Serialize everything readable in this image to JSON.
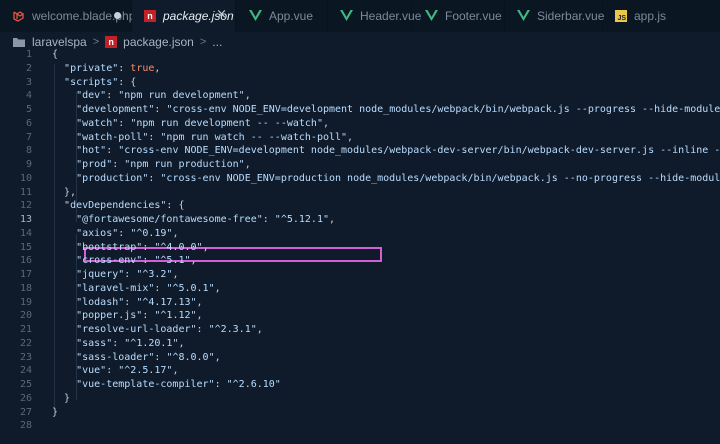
{
  "tabs": [
    {
      "label": "welcome.blade.php",
      "icon": "laravel-icon",
      "state": "modified"
    },
    {
      "label": "package.json",
      "icon": "npm-icon",
      "state": "active"
    },
    {
      "label": "App.vue",
      "icon": "vue-icon"
    },
    {
      "label": "Header.vue",
      "icon": "vue-icon"
    },
    {
      "label": "Footer.vue",
      "icon": "vue-icon"
    },
    {
      "label": "Siderbar.vue",
      "icon": "vue-icon"
    },
    {
      "label": "app.js",
      "icon": "js-icon"
    }
  ],
  "icon_text": {
    "npm": "n",
    "js": "JS"
  },
  "tab_close_glyph": "×",
  "breadcrumb": {
    "folder": "laravelspa",
    "file": "package.json",
    "sep": ">",
    "more": "..."
  },
  "colors": {
    "key": "#b9dcff",
    "string": "#b9dcff",
    "boolean": "#f78c6c",
    "punct": "#c9d1d9",
    "highlight": "#d35fd7",
    "vue": "#41b883"
  },
  "lines": [
    {
      "n": "1",
      "t": "{"
    },
    {
      "n": "2",
      "t": "  \"private\": true,"
    },
    {
      "n": "3",
      "t": "  \"scripts\": {"
    },
    {
      "n": "4",
      "t": "    \"dev\": \"npm run development\","
    },
    {
      "n": "5",
      "t": "    \"development\": \"cross-env NODE_ENV=development node_modules/webpack/bin/webpack.js --progress --hide-modules --config=node_modules/laravel-mix/setup/webpack.config.js\","
    },
    {
      "n": "6",
      "t": "    \"watch\": \"npm run development -- --watch\","
    },
    {
      "n": "7",
      "t": "    \"watch-poll\": \"npm run watch -- --watch-poll\","
    },
    {
      "n": "8",
      "t": "    \"hot\": \"cross-env NODE_ENV=development node_modules/webpack-dev-server/bin/webpack-dev-server.js --inline --hot --config=node_modules/laravel-mix/setup/webpack.config.js\","
    },
    {
      "n": "9",
      "t": "    \"prod\": \"npm run production\","
    },
    {
      "n": "10",
      "t": "    \"production\": \"cross-env NODE_ENV=production node_modules/webpack/bin/webpack.js --no-progress --hide-modules --config=node_modules/laravel-mix/setup/webpack.config.js\""
    },
    {
      "n": "11",
      "t": "  },"
    },
    {
      "n": "12",
      "t": "  \"devDependencies\": {"
    },
    {
      "n": "13",
      "t": "    \"@fortawesome/fontawesome-free\": \"^5.12.1\","
    },
    {
      "n": "14",
      "t": "    \"axios\": \"^0.19\","
    },
    {
      "n": "15",
      "t": "    \"bootstrap\": \"^4.0.0\","
    },
    {
      "n": "16",
      "t": "    \"cross-env\": \"^5.1\","
    },
    {
      "n": "17",
      "t": "    \"jquery\": \"^3.2\","
    },
    {
      "n": "18",
      "t": "    \"laravel-mix\": \"^5.0.1\","
    },
    {
      "n": "19",
      "t": "    \"lodash\": \"^4.17.13\","
    },
    {
      "n": "20",
      "t": "    \"popper.js\": \"^1.12\","
    },
    {
      "n": "21",
      "t": "    \"resolve-url-loader\": \"^2.3.1\","
    },
    {
      "n": "22",
      "t": "    \"sass\": \"^1.20.1\","
    },
    {
      "n": "23",
      "t": "    \"sass-loader\": \"^8.0.0\","
    },
    {
      "n": "24",
      "t": "    \"vue\": \"^2.5.17\","
    },
    {
      "n": "25",
      "t": "    \"vue-template-compiler\": \"^2.6.10\""
    },
    {
      "n": "26",
      "t": "  }"
    },
    {
      "n": "27",
      "t": "}"
    },
    {
      "n": "28",
      "t": ""
    }
  ],
  "highlighted_line": "13"
}
